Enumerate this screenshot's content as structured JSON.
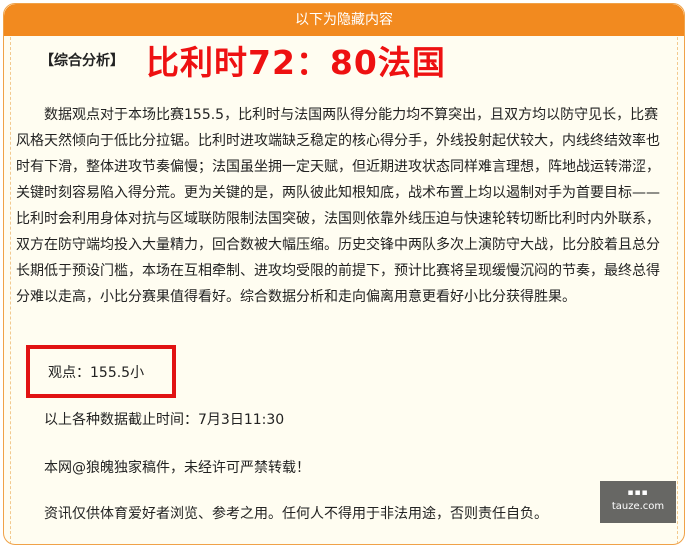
{
  "banner": {
    "text": "以下为隐藏内容"
  },
  "title": {
    "tag": "【综合分析】",
    "headline": "比利时72：80法国"
  },
  "analysis": "数据观点对于本场比赛155.5，比利时与法国两队得分能力均不算突出，且双方均以防守见长，比赛风格天然倾向于低比分拉锯。比利时进攻端缺乏稳定的核心得分手，外线投射起伏较大，内线终结效率也时有下滑，整体进攻节奏偏慢；法国虽坐拥一定天赋，但近期进攻状态同样难言理想，阵地战运转滞涩，关键时刻容易陷入得分荒。更为关键的是，两队彼此知根知底，战术布置上均以遏制对手为首要目标——比利时会利用身体对抗与区域联防限制法国突破，法国则依靠外线压迫与快速轮转切断比利时内外联系，双方在防守端均投入大量精力，回合数被大幅压缩。历史交锋中两队多次上演防守大战，比分胶着且总分长期低于预设门槛，本场在互相牵制、进攻均受限的前提下，预计比赛将呈现缓慢沉闷的节奏，最终总得分难以走高，小比分赛果值得看好。综合数据分析和走向偏离用意更看好小比分获得胜果。",
  "view": "观点：155.5小",
  "cutoff": "以上各种数据截止时间：7月3日11:30",
  "copyright": "本网@狼魄独家稿件，未经许可严禁转载！",
  "disclaimer": "资讯仅供体育爱好者浏览、参考之用。任何人不得用于非法用途，否则责任自负。",
  "watermark": {
    "site": "tauze.com"
  }
}
